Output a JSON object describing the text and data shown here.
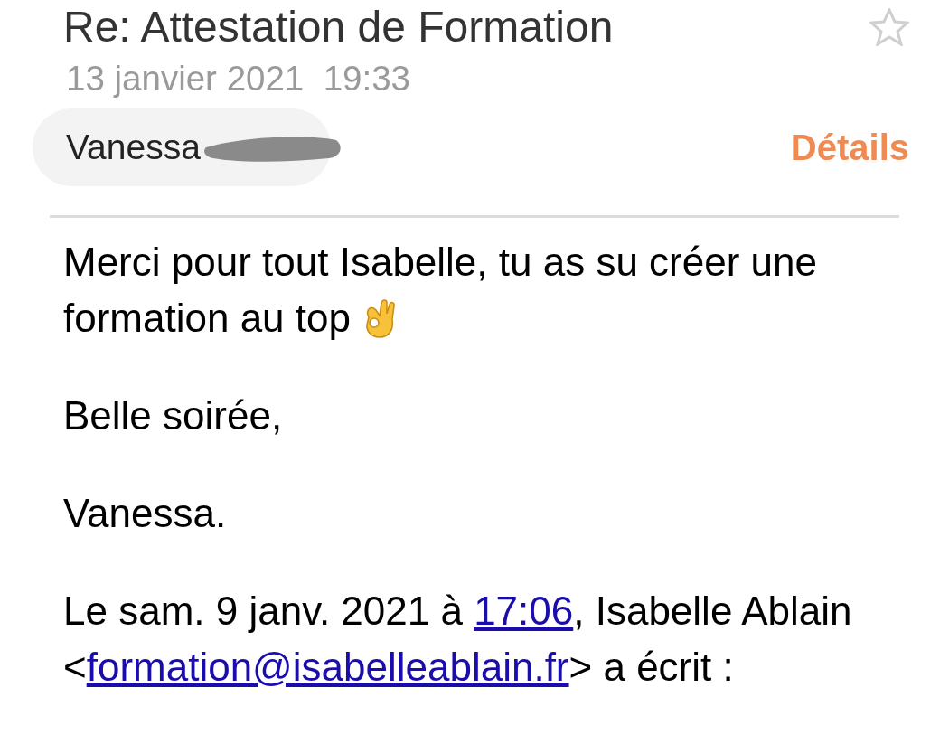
{
  "subject": "Re: Attestation de Formation",
  "starred": false,
  "date": "13 janvier 2021  19:33",
  "sender": {
    "name": "Vanessa",
    "redacted": true
  },
  "details_link": "Détails",
  "body": [
    {
      "text": "Merci pour tout Isabelle, tu as su créer une formation au top",
      "emoji": true
    },
    {
      "text": "Belle soirée,",
      "emoji": false
    },
    {
      "text": "Vanessa.",
      "emoji": false
    }
  ],
  "quote_header": {
    "before": "Le sam. 9 janv. 2021 à ",
    "time": "17:06",
    "middle": ", Isabelle Ablain <",
    "email": "formation@isabelleablain.fr",
    "after": "> a écrit :"
  }
}
